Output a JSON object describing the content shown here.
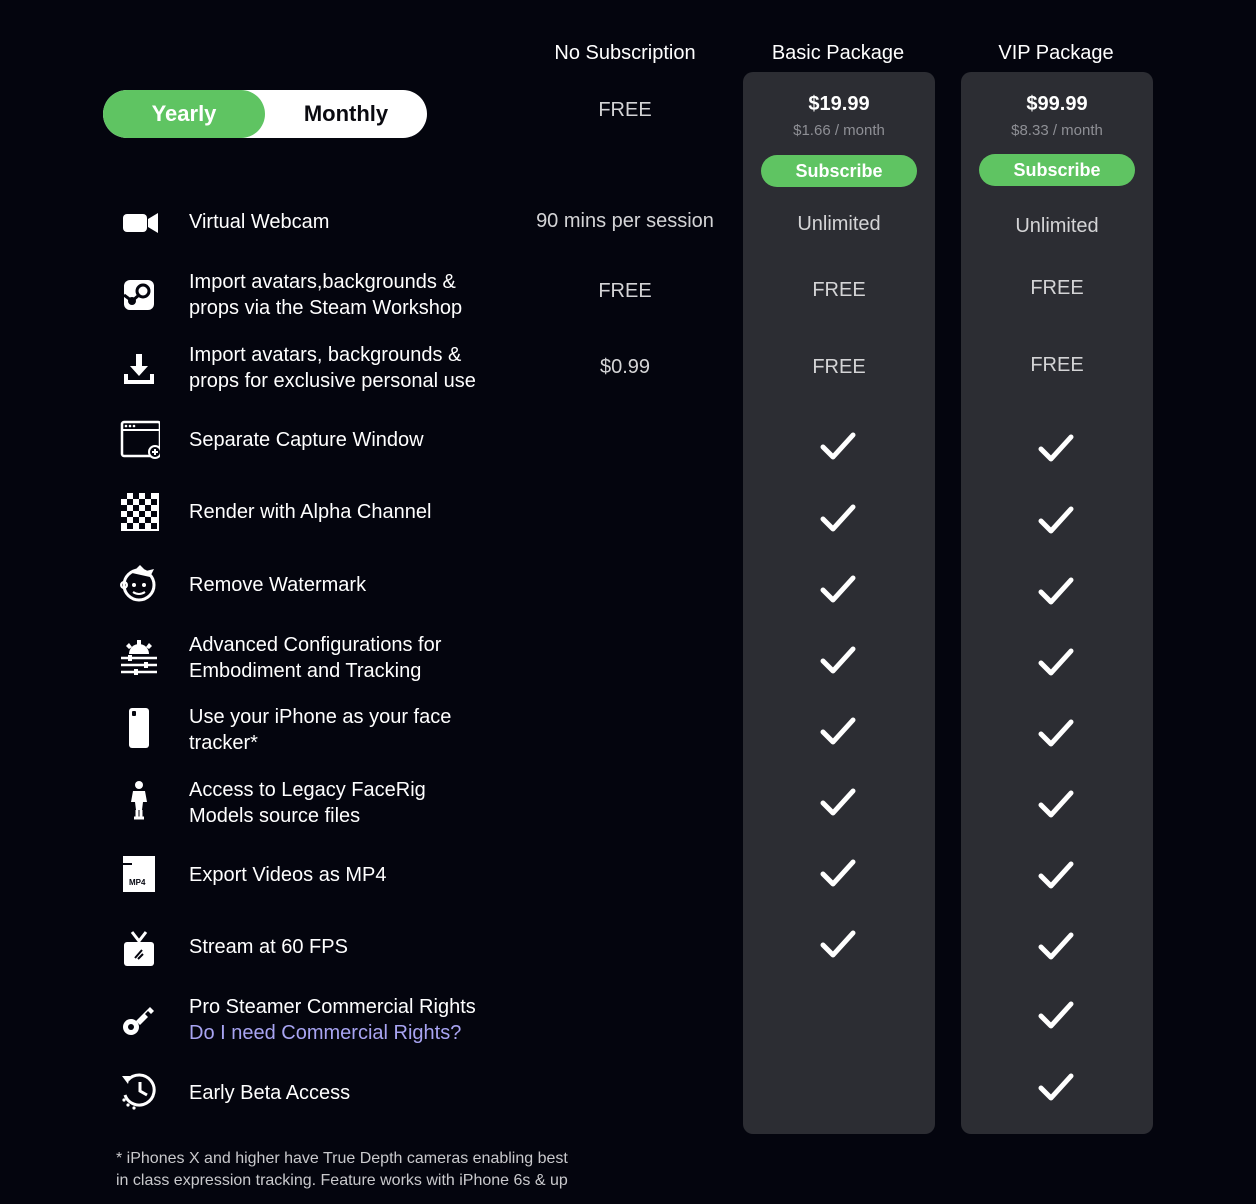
{
  "toggle": {
    "yearly_label": "Yearly",
    "monthly_label": "Monthly",
    "selected": "Yearly"
  },
  "columns": {
    "free": {
      "name": "No Subscription",
      "price": "FREE"
    },
    "basic": {
      "name": "Basic  Package",
      "price": "$19.99",
      "per_month": "$1.66 / month",
      "subscribe_label": "Subscribe"
    },
    "vip": {
      "name": "VIP Package",
      "price": "$99.99",
      "per_month": "$8.33 / month",
      "subscribe_label": "Subscribe"
    }
  },
  "features": [
    {
      "icon": "webcam-icon",
      "label": "Virtual Webcam",
      "free": "90 mins per session",
      "basic": "Unlimited",
      "vip": "Unlimited"
    },
    {
      "icon": "steam-icon",
      "label_line1": "Import avatars,backgrounds &",
      "label_line2": "props via the Steam Workshop",
      "free": "FREE",
      "basic": "FREE",
      "vip": "FREE"
    },
    {
      "icon": "download-icon",
      "label_line1": "Import avatars, backgrounds &",
      "label_line2": "props for exclusive personal use",
      "free": "$0.99",
      "basic": "FREE",
      "vip": "FREE"
    },
    {
      "icon": "capture-window-icon",
      "label": "Separate Capture Window",
      "basic_check": true,
      "vip_check": true
    },
    {
      "icon": "checkerboard-icon",
      "label": "Render with Alpha Channel",
      "basic_check": true,
      "vip_check": true
    },
    {
      "icon": "avatar-face-icon",
      "label": "Remove Watermark",
      "basic_check": true,
      "vip_check": true
    },
    {
      "icon": "gear-sliders-icon",
      "label_line1": "Advanced Configurations for",
      "label_line2": "Embodiment and Tracking",
      "basic_check": true,
      "vip_check": true
    },
    {
      "icon": "iphone-icon",
      "label_line1": "Use your iPhone as your face",
      "label_line2": "tracker*",
      "basic_check": true,
      "vip_check": true
    },
    {
      "icon": "figure-icon",
      "label_line1": "Access to Legacy FaceRig",
      "label_line2": "Models source files",
      "basic_check": true,
      "vip_check": true
    },
    {
      "icon": "mp4-file-icon",
      "icon_text": "MP4",
      "label": "Export Videos as MP4",
      "basic_check": true,
      "vip_check": true
    },
    {
      "icon": "tv-icon",
      "label": "Stream at 60 FPS",
      "basic_check": true,
      "vip_check": true
    },
    {
      "icon": "key-icon",
      "label_line1": "Pro Steamer Commercial Rights",
      "link_text": "Do I need Commercial Rights?",
      "basic_check": false,
      "vip_check": true
    },
    {
      "icon": "history-icon",
      "label": "Early Beta Access",
      "basic_check": false,
      "vip_check": true
    }
  ],
  "footnote": {
    "line1": "* iPhones X and higher have True Depth cameras enabling best",
    "line2": "in class expression tracking. Feature works with iPhone 6s & up"
  },
  "colors": {
    "background": "#04050e",
    "card": "#2c2d33",
    "accent_green": "#5fc462",
    "link": "#a8a4f2",
    "muted": "#8e8f95"
  }
}
